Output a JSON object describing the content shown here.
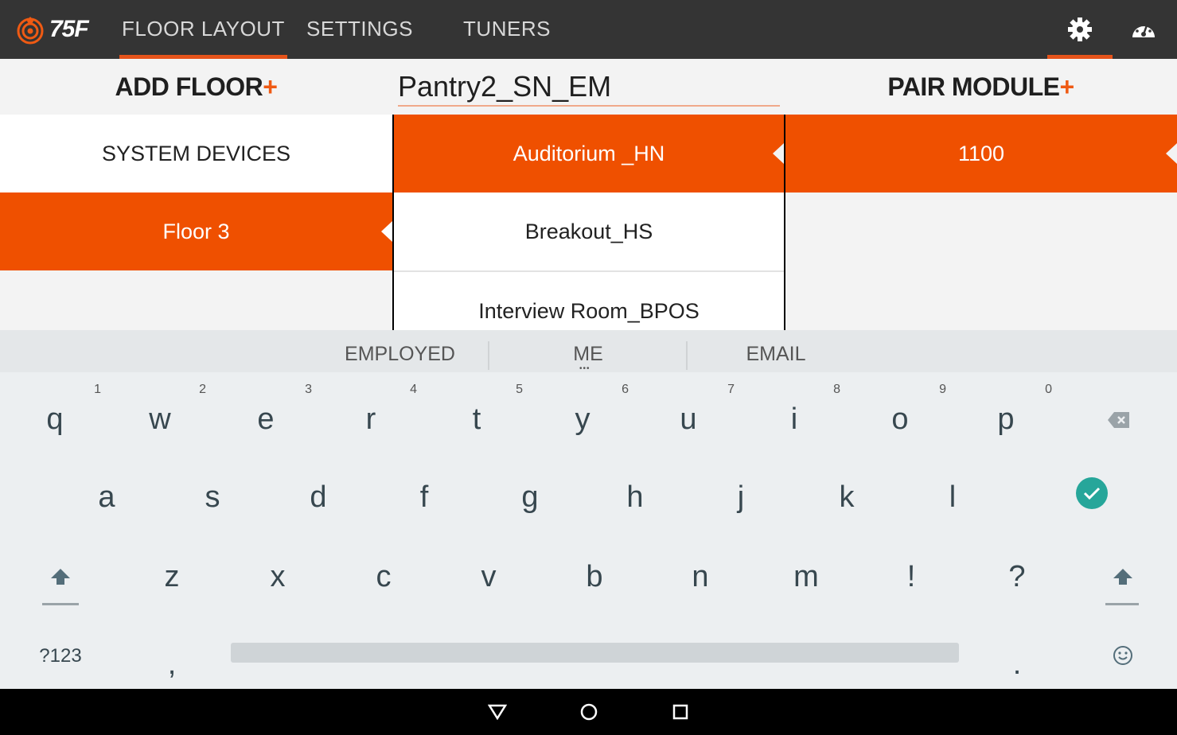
{
  "app": {
    "logo_text": "75F",
    "logo_icon": "75f-logo-icon",
    "accent": "#ef5000",
    "topbar_color": "#343434"
  },
  "nav": {
    "tabs": [
      "FLOOR LAYOUT",
      "SETTINGS",
      "TUNERS"
    ],
    "active_tab": "FLOOR LAYOUT",
    "right_icons": [
      "gear-icon",
      "dashboard-icon"
    ]
  },
  "header": {
    "add_floor_label": "ADD FLOOR",
    "name_input_value": "Pantry2_SN_EM",
    "pair_module_label": "PAIR MODULE",
    "plus": "+"
  },
  "floors": {
    "items": [
      "SYSTEM DEVICES",
      "Floor 3"
    ],
    "selected": "Floor 3"
  },
  "zones": {
    "items": [
      "Auditorium _HN",
      "Breakout_HS",
      "Interview Room_BPOS"
    ],
    "selected": "Auditorium _HN"
  },
  "modules": {
    "items": [
      "1100"
    ],
    "selected": "1100"
  },
  "keyboard": {
    "suggestions": [
      "EMPLOYED",
      "ME",
      "EMAIL"
    ],
    "row1": [
      "q",
      "w",
      "e",
      "r",
      "t",
      "y",
      "u",
      "i",
      "o",
      "p"
    ],
    "row1_hints": [
      "1",
      "2",
      "3",
      "4",
      "5",
      "6",
      "7",
      "8",
      "9",
      "0"
    ],
    "row2": [
      "a",
      "s",
      "d",
      "f",
      "g",
      "h",
      "j",
      "k",
      "l"
    ],
    "row3": [
      "z",
      "x",
      "c",
      "v",
      "b",
      "n",
      "m",
      "!",
      "?"
    ],
    "symbols_key": "?123",
    "comma": ",",
    "period": ".",
    "enter_color": "#26a69a"
  },
  "system_nav": [
    "back-icon",
    "home-icon",
    "recents-icon"
  ]
}
